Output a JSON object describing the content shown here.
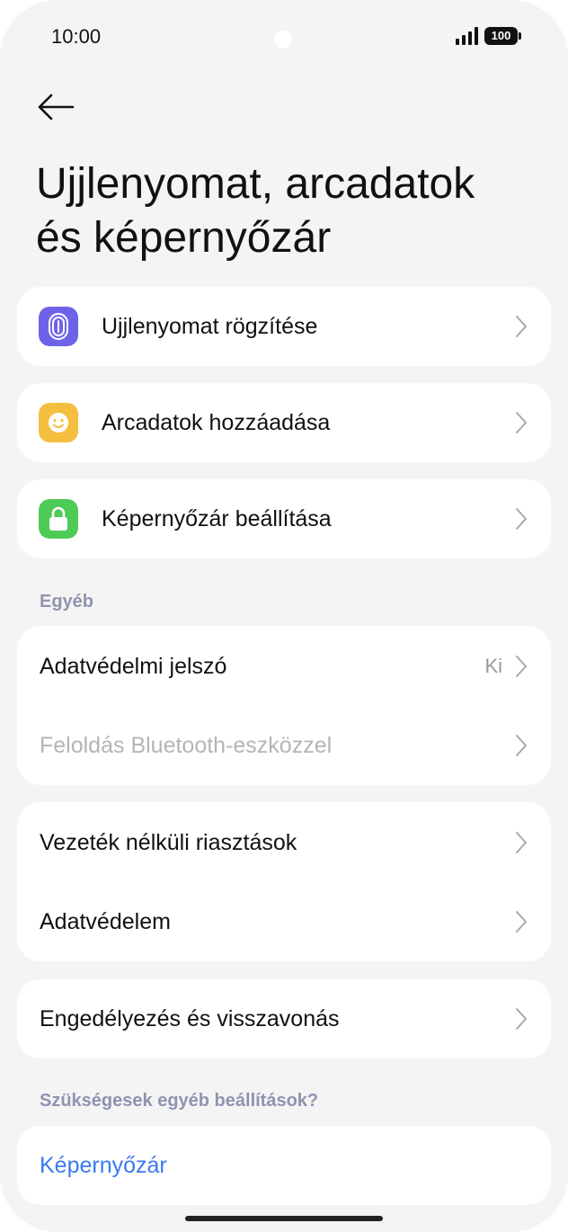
{
  "status_bar": {
    "time": "10:00",
    "battery": "100"
  },
  "header": {
    "title_line1": "Ujjlenyomat, arcadatok",
    "title_line2": "és képernyőzár"
  },
  "security_items": [
    {
      "label": "Ujjlenyomat rögzítése",
      "icon": "fingerprint-icon",
      "color": "#6e63e8"
    },
    {
      "label": "Arcadatok hozzáadása",
      "icon": "face-icon",
      "color": "#f4bf3f"
    },
    {
      "label": "Képernyőzár beállítása",
      "icon": "lock-icon",
      "color": "#4ecb57"
    }
  ],
  "other_section": {
    "title": "Egyéb",
    "items": [
      {
        "label": "Adatvédelmi jelszó",
        "value": "Ki"
      },
      {
        "label": "Feloldás Bluetooth-eszközzel",
        "disabled": true
      }
    ]
  },
  "group2": [
    {
      "label": "Vezeték nélküli riasztások"
    },
    {
      "label": "Adatvédelem"
    }
  ],
  "group3": [
    {
      "label": "Engedélyezés és visszavonás"
    }
  ],
  "suggestions": {
    "title": "Szükségesek egyéb beállítások?",
    "link": "Képernyőzár"
  },
  "colors": {
    "accent": "#3a78ef",
    "background": "#f4f4f4",
    "section_label": "#8f93b0"
  }
}
